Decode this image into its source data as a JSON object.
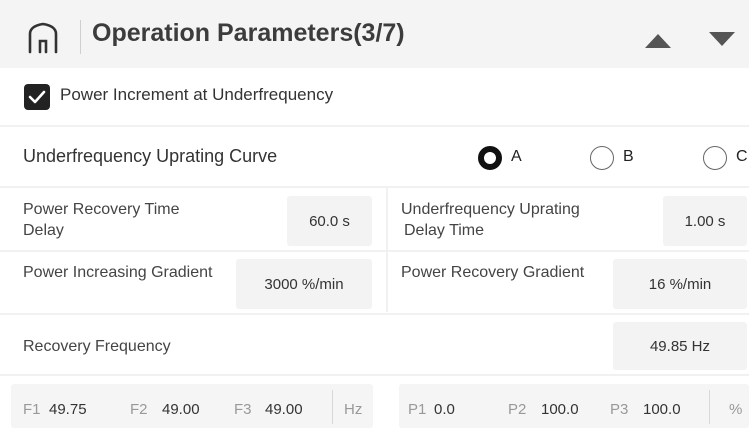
{
  "header": {
    "title": "Operation Parameters(3/7)",
    "icons": [
      "home-icon",
      "arrow-up-icon",
      "arrow-down-icon"
    ]
  },
  "power_increment": {
    "label": "Power Increment at Underfrequency",
    "checked": true
  },
  "curve": {
    "label": "Underfrequency Uprating Curve",
    "options": [
      "A",
      "B",
      "C"
    ],
    "selected": "A"
  },
  "fields": {
    "power_recovery_time_delay": {
      "label_line1": "Power Recovery Time",
      "label_line2": "Delay",
      "value": "60.0 s"
    },
    "underfrequency_uprating_delay": {
      "label_line1": "Underfrequency Uprating",
      "label_line2": "Delay Time",
      "value": "1.00 s"
    },
    "power_increasing_gradient": {
      "label": "Power Increasing Gradient",
      "value": "3000 %/min"
    },
    "power_recovery_gradient": {
      "label": "Power Recovery Gradient",
      "value": "16 %/min"
    },
    "recovery_frequency": {
      "label": "Recovery Frequency",
      "value": "49.85 Hz"
    }
  },
  "frequency_points": {
    "items": [
      {
        "label": "F1",
        "value": "49.75"
      },
      {
        "label": "F2",
        "value": "49.00"
      },
      {
        "label": "F3",
        "value": "49.00"
      }
    ],
    "unit": "Hz"
  },
  "power_points": {
    "items": [
      {
        "label": "P1",
        "value": "0.0"
      },
      {
        "label": "P2",
        "value": "100.0"
      },
      {
        "label": "P3",
        "value": "100.0"
      }
    ],
    "unit": "%"
  },
  "colors": {
    "header_bg": "#f4f4f4",
    "field_bg": "#f3f3f3",
    "accent": "#111111"
  }
}
